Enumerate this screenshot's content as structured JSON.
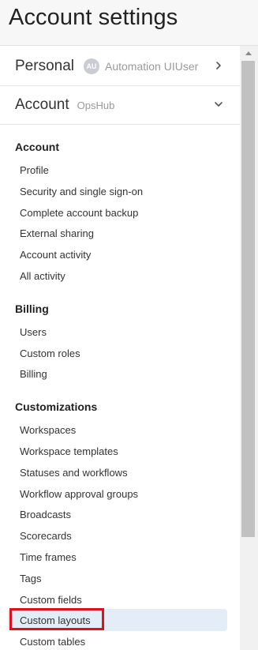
{
  "header": {
    "title": "Account settings"
  },
  "personal": {
    "title": "Personal",
    "avatar_initials": "AU",
    "user_name": "Automation UIUser"
  },
  "account": {
    "title": "Account",
    "org_name": "OpsHub"
  },
  "sections": {
    "account": {
      "heading": "Account",
      "items": [
        "Profile",
        "Security and single sign-on",
        "Complete account backup",
        "External sharing",
        "Account activity",
        "All activity"
      ]
    },
    "billing": {
      "heading": "Billing",
      "items": [
        "Users",
        "Custom roles",
        "Billing"
      ]
    },
    "customizations": {
      "heading": "Customizations",
      "items": [
        "Workspaces",
        "Workspace templates",
        "Statuses and workflows",
        "Workflow approval groups",
        "Broadcasts",
        "Scorecards",
        "Time frames",
        "Tags",
        "Custom fields",
        "Custom layouts",
        "Custom tables"
      ]
    }
  },
  "selected_item": "Custom layouts",
  "colors": {
    "highlight": "#e3edf8",
    "focus_outline": "#e00f1c"
  },
  "icons": {
    "personal_toggle": "chevron-right-icon",
    "account_toggle": "chevron-down-icon",
    "scroll_up": "scroll-up-arrow-icon"
  }
}
